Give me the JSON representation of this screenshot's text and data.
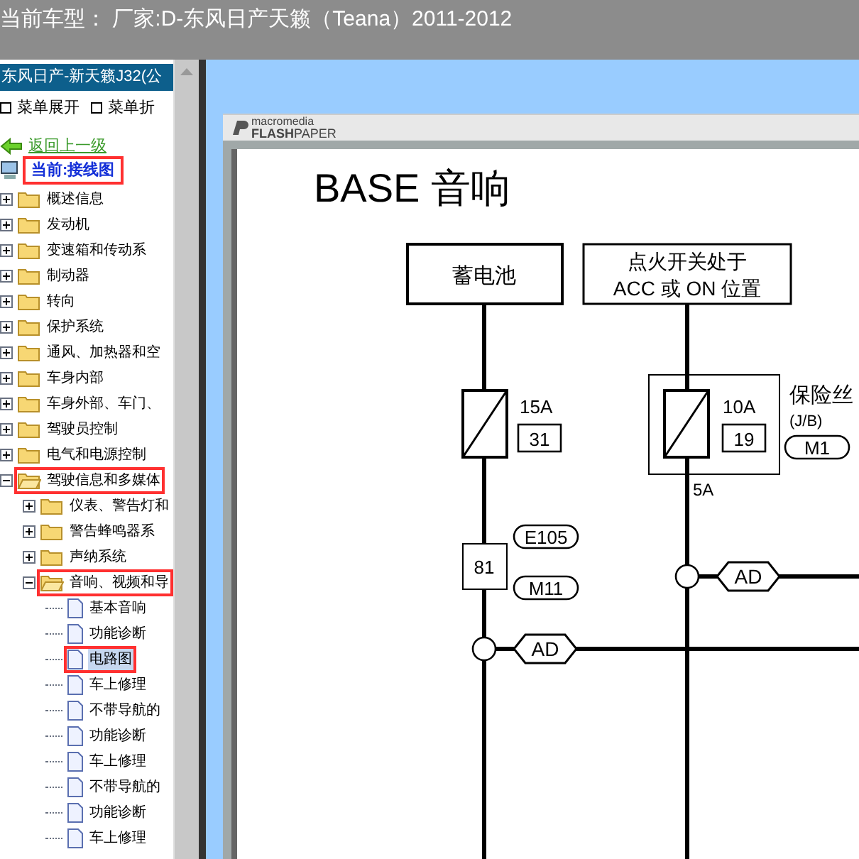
{
  "window": {
    "title": "当前车型： 厂家:D-东风日产天籁（Teana）2011-2012"
  },
  "sidebar": {
    "header": "东风日产-新天籁J32(公",
    "menu": [
      "菜单展开",
      "菜单折"
    ],
    "back_link": "返回上一级",
    "current": {
      "label": "当前:接线图",
      "annotated": true
    },
    "tree": [
      {
        "label": "概述信息",
        "kind": "folder",
        "expanded": false,
        "annotated": false
      },
      {
        "label": "发动机",
        "kind": "folder",
        "expanded": false,
        "annotated": false
      },
      {
        "label": "变速箱和传动系",
        "kind": "folder",
        "expanded": false,
        "annotated": false
      },
      {
        "label": "制动器",
        "kind": "folder",
        "expanded": false,
        "annotated": false
      },
      {
        "label": "转向",
        "kind": "folder",
        "expanded": false,
        "annotated": false
      },
      {
        "label": "保护系统",
        "kind": "folder",
        "expanded": false,
        "annotated": false
      },
      {
        "label": "通风、加热器和空",
        "kind": "folder",
        "expanded": false,
        "annotated": false
      },
      {
        "label": "车身内部",
        "kind": "folder",
        "expanded": false,
        "annotated": false
      },
      {
        "label": "车身外部、车门、",
        "kind": "folder",
        "expanded": false,
        "annotated": false
      },
      {
        "label": "驾驶员控制",
        "kind": "folder",
        "expanded": false,
        "annotated": false
      },
      {
        "label": "电气和电源控制",
        "kind": "folder",
        "expanded": false,
        "annotated": false
      },
      {
        "label": "驾驶信息和多媒体",
        "kind": "folder",
        "expanded": true,
        "annotated": true,
        "children": [
          {
            "label": "仪表、警告灯和",
            "kind": "folder",
            "expanded": false,
            "annotated": false
          },
          {
            "label": "警告蜂鸣器系",
            "kind": "folder",
            "expanded": false,
            "annotated": false
          },
          {
            "label": "声纳系统",
            "kind": "folder",
            "expanded": false,
            "annotated": false
          },
          {
            "label": "音响、视频和导",
            "kind": "folder",
            "expanded": true,
            "annotated": true,
            "children": [
              {
                "label": "基本音响",
                "kind": "page",
                "selected": false,
                "annotated": false
              },
              {
                "label": "功能诊断",
                "kind": "page",
                "selected": false,
                "annotated": false
              },
              {
                "label": "电路图",
                "kind": "page",
                "selected": true,
                "annotated": true
              },
              {
                "label": "车上修理",
                "kind": "page",
                "selected": false,
                "annotated": false
              },
              {
                "label": "不带导航的",
                "kind": "page",
                "selected": false,
                "annotated": false
              },
              {
                "label": "功能诊断",
                "kind": "page",
                "selected": false,
                "annotated": false
              },
              {
                "label": "车上修理",
                "kind": "page",
                "selected": false,
                "annotated": false
              },
              {
                "label": "不带导航的",
                "kind": "page",
                "selected": false,
                "annotated": false
              },
              {
                "label": "功能诊断",
                "kind": "page",
                "selected": false,
                "annotated": false
              },
              {
                "label": "车上修理",
                "kind": "page",
                "selected": false,
                "annotated": false
              }
            ]
          }
        ]
      }
    ]
  },
  "viewer": {
    "brand_top": "macromedia",
    "brand_bold": "FLASH",
    "brand_rest": "PAPER",
    "document": {
      "title": "BASE 音响",
      "battery": "蓄电池",
      "ignition": [
        "点火开关处于",
        "ACC 或 ON 位置"
      ],
      "fuse_left": {
        "rating": "15A",
        "number": "31"
      },
      "fuse_right": {
        "rating": "10A",
        "number": "19"
      },
      "fuse_box": [
        "保险丝",
        "(J/B)"
      ],
      "fuse_box_connector": "M1",
      "current_label": "5A",
      "terminal": "81",
      "connectors": [
        "E105",
        "M11"
      ],
      "splices": [
        "AD",
        "AD"
      ]
    }
  }
}
